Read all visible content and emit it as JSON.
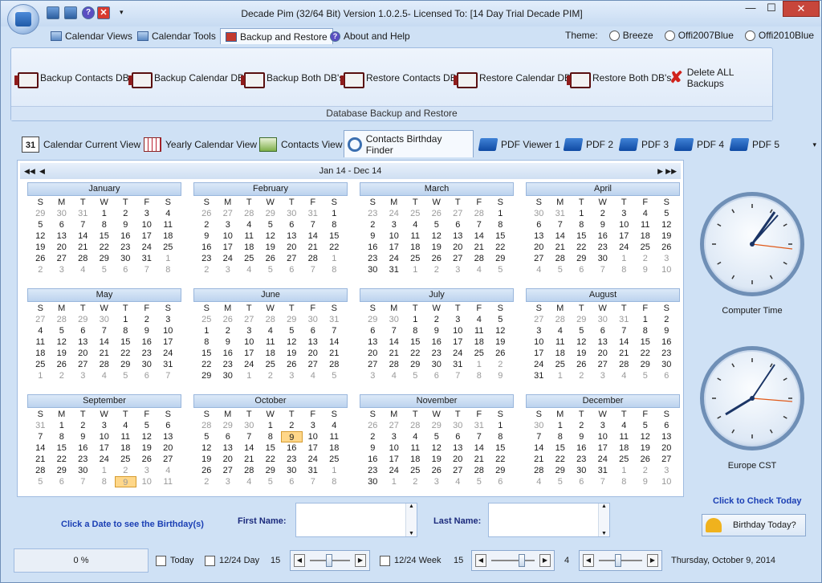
{
  "window": {
    "title": "Decade Pim (32/64 Bit) Version 1.0.2.5- Licensed To: [14 Day Trial Decade PIM]",
    "min": "—",
    "max": "☐",
    "close": "✕"
  },
  "quick_access": {
    "help": "?",
    "close": "✕",
    "dropdown": "▾"
  },
  "menu": {
    "tabs": [
      {
        "label": "Calendar Views"
      },
      {
        "label": "Calendar Tools"
      },
      {
        "label": "Backup and Restore"
      },
      {
        "label": "About and Help"
      }
    ],
    "theme_label": "Theme:",
    "themes": [
      "Breeze",
      "Offi2007Blue",
      "Offi2010Blue"
    ]
  },
  "ribbon": {
    "buttons": [
      "Backup Contacts DB",
      "Backup Calendar DB",
      "Backup Both DB's",
      "Restore Contacts DB",
      "Restore Calendar DB",
      "Restore Both DB's",
      "Delete ALL Backups"
    ],
    "group_label": "Database Backup and Restore"
  },
  "view_tabs": [
    {
      "label": "Calendar Current View",
      "icon": "31"
    },
    {
      "label": "Yearly Calendar View"
    },
    {
      "label": "Contacts View"
    },
    {
      "label": "Contacts Birthday Finder"
    },
    {
      "label": "PDF Viewer 1"
    },
    {
      "label": "PDF 2"
    },
    {
      "label": "PDF 3"
    },
    {
      "label": "PDF 4"
    },
    {
      "label": "PDF 5"
    }
  ],
  "calendar": {
    "range": "Jan 14 - Dec 14",
    "nav_prev2": "◀◀",
    "nav_prev": "◀",
    "nav_next": "▶",
    "nav_next2": "▶▶",
    "weekdays": [
      "S",
      "M",
      "T",
      "W",
      "T",
      "F",
      "S"
    ],
    "months": [
      {
        "name": "January",
        "days": [
          "29",
          "30",
          "31",
          "1",
          "2",
          "3",
          "4",
          "5",
          "6",
          "7",
          "8",
          "9",
          "10",
          "11",
          "12",
          "13",
          "14",
          "15",
          "16",
          "17",
          "18",
          "19",
          "20",
          "21",
          "22",
          "23",
          "24",
          "25",
          "26",
          "27",
          "28",
          "29",
          "30",
          "31",
          "1",
          "2",
          "3",
          "4",
          "5",
          "6",
          "7",
          "8"
        ],
        "lead": 3,
        "trail": 8
      },
      {
        "name": "February",
        "days": [
          "26",
          "27",
          "28",
          "29",
          "30",
          "31",
          "1",
          "2",
          "3",
          "4",
          "5",
          "6",
          "7",
          "8",
          "9",
          "10",
          "11",
          "12",
          "13",
          "14",
          "15",
          "16",
          "17",
          "18",
          "19",
          "20",
          "21",
          "22",
          "23",
          "24",
          "25",
          "26",
          "27",
          "28",
          "1",
          "2",
          "3",
          "4",
          "5",
          "6",
          "7",
          "8"
        ],
        "lead": 6,
        "trail": 8
      },
      {
        "name": "March",
        "days": [
          "23",
          "24",
          "25",
          "26",
          "27",
          "28",
          "1",
          "2",
          "3",
          "4",
          "5",
          "6",
          "7",
          "8",
          "9",
          "10",
          "11",
          "12",
          "13",
          "14",
          "15",
          "16",
          "17",
          "18",
          "19",
          "20",
          "21",
          "22",
          "23",
          "24",
          "25",
          "26",
          "27",
          "28",
          "29",
          "30",
          "31",
          "1",
          "2",
          "3",
          "4",
          "5"
        ],
        "lead": 6,
        "trail": 5
      },
      {
        "name": "April",
        "days": [
          "30",
          "31",
          "1",
          "2",
          "3",
          "4",
          "5",
          "6",
          "7",
          "8",
          "9",
          "10",
          "11",
          "12",
          "13",
          "14",
          "15",
          "16",
          "17",
          "18",
          "19",
          "20",
          "21",
          "22",
          "23",
          "24",
          "25",
          "26",
          "27",
          "28",
          "29",
          "30",
          "1",
          "2",
          "3",
          "4",
          "5",
          "6",
          "7",
          "8",
          "9",
          "10"
        ],
        "lead": 2,
        "trail": 10
      },
      {
        "name": "May",
        "days": [
          "27",
          "28",
          "29",
          "30",
          "1",
          "2",
          "3",
          "4",
          "5",
          "6",
          "7",
          "8",
          "9",
          "10",
          "11",
          "12",
          "13",
          "14",
          "15",
          "16",
          "17",
          "18",
          "19",
          "20",
          "21",
          "22",
          "23",
          "24",
          "25",
          "26",
          "27",
          "28",
          "29",
          "30",
          "31",
          "1",
          "2",
          "3",
          "4",
          "5",
          "6",
          "7"
        ],
        "lead": 4,
        "trail": 7
      },
      {
        "name": "June",
        "days": [
          "25",
          "26",
          "27",
          "28",
          "29",
          "30",
          "31",
          "1",
          "2",
          "3",
          "4",
          "5",
          "6",
          "7",
          "8",
          "9",
          "10",
          "11",
          "12",
          "13",
          "14",
          "15",
          "16",
          "17",
          "18",
          "19",
          "20",
          "21",
          "22",
          "23",
          "24",
          "25",
          "26",
          "27",
          "28",
          "29",
          "30",
          "1",
          "2",
          "3",
          "4",
          "5"
        ],
        "lead": 7,
        "trail": 5
      },
      {
        "name": "July",
        "days": [
          "29",
          "30",
          "1",
          "2",
          "3",
          "4",
          "5",
          "6",
          "7",
          "8",
          "9",
          "10",
          "11",
          "12",
          "13",
          "14",
          "15",
          "16",
          "17",
          "18",
          "19",
          "20",
          "21",
          "22",
          "23",
          "24",
          "25",
          "26",
          "27",
          "28",
          "29",
          "30",
          "31",
          "1",
          "2",
          "3",
          "4",
          "5",
          "6",
          "7",
          "8",
          "9"
        ],
        "lead": 2,
        "trail": 9
      },
      {
        "name": "August",
        "days": [
          "27",
          "28",
          "29",
          "30",
          "31",
          "1",
          "2",
          "3",
          "4",
          "5",
          "6",
          "7",
          "8",
          "9",
          "10",
          "11",
          "12",
          "13",
          "14",
          "15",
          "16",
          "17",
          "18",
          "19",
          "20",
          "21",
          "22",
          "23",
          "24",
          "25",
          "26",
          "27",
          "28",
          "29",
          "30",
          "31",
          "1",
          "2",
          "3",
          "4",
          "5",
          "6"
        ],
        "lead": 5,
        "trail": 6
      },
      {
        "name": "September",
        "days": [
          "31",
          "1",
          "2",
          "3",
          "4",
          "5",
          "6",
          "7",
          "8",
          "9",
          "10",
          "11",
          "12",
          "13",
          "14",
          "15",
          "16",
          "17",
          "18",
          "19",
          "20",
          "21",
          "22",
          "23",
          "24",
          "25",
          "26",
          "27",
          "28",
          "29",
          "30",
          "1",
          "2",
          "3",
          "4",
          "5",
          "6",
          "7",
          "8",
          "9",
          "10",
          "11"
        ],
        "lead": 1,
        "trail": 11,
        "selected": 39
      },
      {
        "name": "October",
        "days": [
          "28",
          "29",
          "30",
          "1",
          "2",
          "3",
          "4",
          "5",
          "6",
          "7",
          "8",
          "9",
          "10",
          "11",
          "12",
          "13",
          "14",
          "15",
          "16",
          "17",
          "18",
          "19",
          "20",
          "21",
          "22",
          "23",
          "24",
          "25",
          "26",
          "27",
          "28",
          "29",
          "30",
          "31",
          "1",
          "2",
          "3",
          "4",
          "5",
          "6",
          "7",
          "8"
        ],
        "lead": 3,
        "trail": 8,
        "selected": 11
      },
      {
        "name": "November",
        "days": [
          "26",
          "27",
          "28",
          "29",
          "30",
          "31",
          "1",
          "2",
          "3",
          "4",
          "5",
          "6",
          "7",
          "8",
          "9",
          "10",
          "11",
          "12",
          "13",
          "14",
          "15",
          "16",
          "17",
          "18",
          "19",
          "20",
          "21",
          "22",
          "23",
          "24",
          "25",
          "26",
          "27",
          "28",
          "29",
          "30",
          "1",
          "2",
          "3",
          "4",
          "5",
          "6"
        ],
        "lead": 6,
        "trail": 6
      },
      {
        "name": "December",
        "days": [
          "30",
          "1",
          "2",
          "3",
          "4",
          "5",
          "6",
          "7",
          "8",
          "9",
          "10",
          "11",
          "12",
          "13",
          "14",
          "15",
          "16",
          "17",
          "18",
          "19",
          "20",
          "21",
          "22",
          "23",
          "24",
          "25",
          "26",
          "27",
          "28",
          "29",
          "30",
          "31",
          "1",
          "2",
          "3",
          "4",
          "5",
          "6",
          "7",
          "8",
          "9",
          "10"
        ],
        "lead": 1,
        "trail": 10
      }
    ]
  },
  "clocks": [
    {
      "label": "Computer Time"
    },
    {
      "label": "Europe CST"
    }
  ],
  "birthday": {
    "hint": "Click a Date to see the Birthday(s)",
    "first_name_label": "First Name:",
    "last_name_label": "Last Name:",
    "first_name_value": "",
    "last_name_value": "",
    "check_today": "Click to Check Today",
    "button": "Birthday Today?",
    "scroll_up": "▲",
    "scroll_down": "▼"
  },
  "statusbar": {
    "progress_text": "0 %",
    "progress": 0,
    "today_label": "Today",
    "h24_label": "12/24 Day",
    "val1": "15",
    "week_label": "12/24 Week",
    "val2": "15",
    "val3": "4",
    "date": "Thursday, October 9, 2014",
    "left": "◀",
    "right": "▶"
  }
}
